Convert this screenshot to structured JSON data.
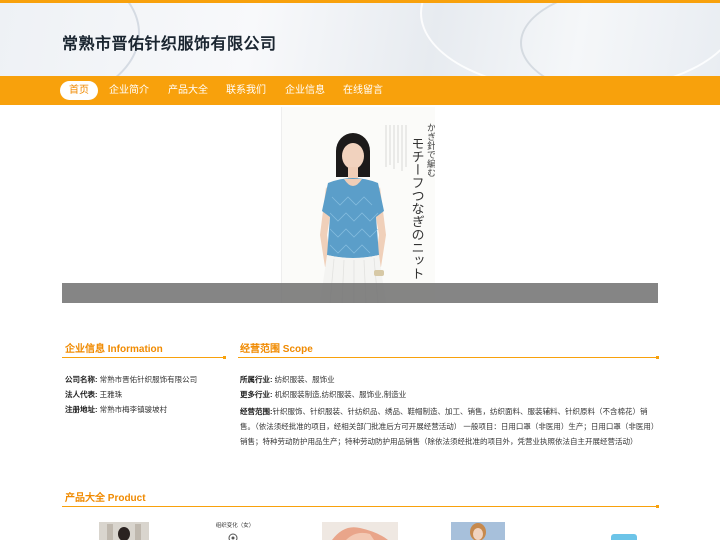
{
  "header": {
    "site_title": "常熟市晋佑针织服饰有限公司"
  },
  "nav": {
    "items": [
      {
        "label": "首页",
        "active": true
      },
      {
        "label": "企业简介",
        "active": false
      },
      {
        "label": "产品大全",
        "active": false
      },
      {
        "label": "联系我们",
        "active": false
      },
      {
        "label": "企业信息",
        "active": false
      },
      {
        "label": "在线留言",
        "active": false
      }
    ]
  },
  "banner": {
    "magazine_line1": "かぎ針で編む",
    "magazine_line2": "モチーフつなぎのニット"
  },
  "company_info": {
    "title": "企业信息 Information",
    "rows": [
      {
        "label": "公司名称:",
        "value": "常熟市晋佑针织服饰有限公司"
      },
      {
        "label": "法人代表:",
        "value": "王雅珠"
      },
      {
        "label": "注册地址:",
        "value": "常熟市梅李镇骏坡村"
      }
    ]
  },
  "scope": {
    "title": "经营范围 Scope",
    "industry_label": "所属行业:",
    "industry_value": "纺织服装、服饰业",
    "more_label": "更多行业:",
    "more_value": "机织服装制造,纺织服装、服饰业,制造业",
    "range_label": "经营范围:",
    "range_value": "针织服饰、针织服装、针纺织品、绣品、鞋帽制造、加工、销售，纺织面料、服装辅料、针织原料（不含棉花）销售。（依法须经批准的项目，经相关部门批准后方可开展经营活动） 一般项目：日用口罩（非医用）生产；日用口罩（非医用）销售；特种劳动防护用品生产；特种劳动防护用品销售（除依法须经批准的项目外，凭营业执照依法自主开展经营活动）"
  },
  "products": {
    "title": "产品大全 Product",
    "thumb2_caption": "组织变化（女）"
  },
  "colors": {
    "accent": "#f8a10c",
    "accent_text": "#f08a00",
    "banner_strip": "#707070"
  }
}
